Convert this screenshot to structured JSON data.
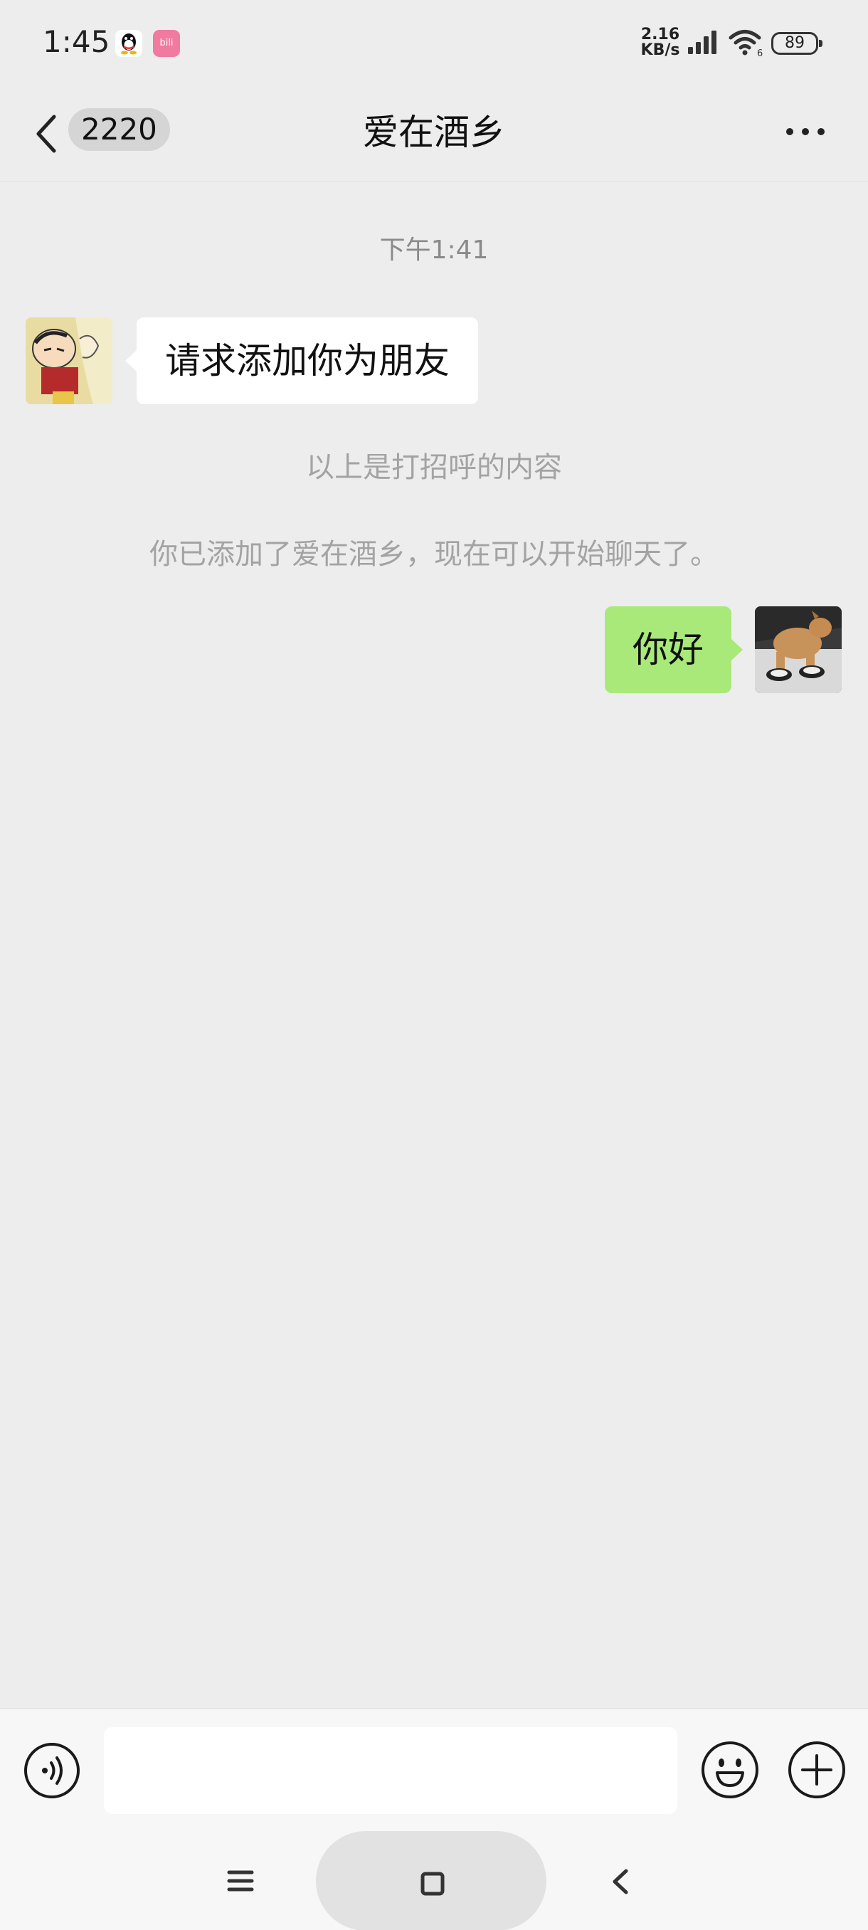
{
  "status_bar": {
    "time": "1:45",
    "net_speed_value": "2.16",
    "net_speed_unit": "KB/s",
    "battery": "89",
    "icons": [
      "qq-icon",
      "bilibili-icon",
      "signal-icon",
      "wifi-icon",
      "battery-icon"
    ],
    "bili_label": "bili"
  },
  "nav": {
    "back_icon": "chevron-left-icon",
    "unread_count": "2220",
    "title": "爱在酒乡",
    "more_icon": "more-dots-icon"
  },
  "messages": {
    "timestamp": "下午1:41",
    "incoming": {
      "text": "请求添加你为朋友",
      "avatar": "cartoon-avatar"
    },
    "note_greeting": "以上是打招呼的内容",
    "note_added": "你已添加了爱在酒乡，现在可以开始聊天了。",
    "outgoing": {
      "text": "你好",
      "avatar": "dog-avatar"
    }
  },
  "input_bar": {
    "voice_icon": "voice-icon",
    "input_value": "",
    "emoji_icon": "emoji-icon",
    "plus_icon": "plus-icon"
  },
  "system_nav": {
    "menu_icon": "menu-icon",
    "home_icon": "home-square-icon",
    "back_icon": "back-chevron-icon"
  },
  "colors": {
    "background": "#ededed",
    "outgoing_bubble": "#a9e97a",
    "incoming_bubble": "#ffffff",
    "note_text": "#a3a3a3",
    "timestamp_text": "#8a8a8a",
    "input_bar": "#f7f7f7"
  }
}
